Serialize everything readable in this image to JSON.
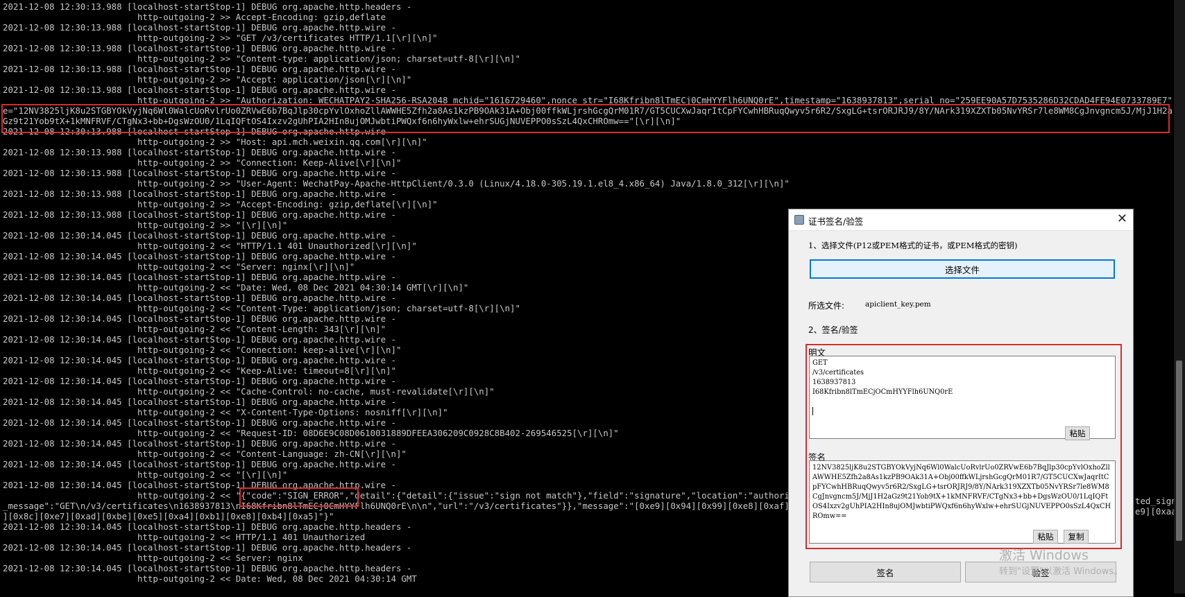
{
  "console": {
    "lines_top": [
      "2021-12-08 12:30:13.988 [localhost-startStop-1] DEBUG org.apache.http.headers -",
      "                          http-outgoing-2 >> Accept-Encoding: gzip,deflate",
      "2021-12-08 12:30:13.988 [localhost-startStop-1] DEBUG org.apache.http.wire -",
      "                          http-outgoing-2 >> \"GET /v3/certificates HTTP/1.1[\\r][\\n]\"",
      "2021-12-08 12:30:13.988 [localhost-startStop-1] DEBUG org.apache.http.wire -",
      "                          http-outgoing-2 >> \"Content-type: application/json; charset=utf-8[\\r][\\n]\"",
      "2021-12-08 12:30:13.988 [localhost-startStop-1] DEBUG org.apache.http.wire -",
      "                          http-outgoing-2 >> \"Accept: application/json[\\r][\\n]\"",
      "2021-12-08 12:30:13.988 [localhost-startStop-1] DEBUG org.apache.http.wire -",
      "                          http-outgoing-2 >> \"Authorization: WECHATPAY2-SHA256-RSA2048 mchid=\"1616729460\",nonce_str=\"I68Kfribn8lTmECj0CmHYYFlh6UNQ0rE\",timestamp=\"1638937813\",serial_no=\"259EE90A57D7535286D32CDAD4FE94E0733789E7\",signatur"
    ],
    "signature_lines": [
      "e=\"12NV3825ljK8u2STGBYOkVyjNq6Wl0WalcUoRvlrUo0ZRVwE6b7BqJlp30cpYvlOxhoZllAWWHE5Zfh2a8As1kzPB9OAk31A+Obj00ffkWLjrshGcgQrM01R7/GT5CUCXwJaqrItCpFYCwhHBRuqQwyv5r6R2/SxgLG+tsrORJRJ9/8Y/NArk319XZXTb05NvYRSr7le8WM8CgJnvgncm5J/MjJ1H2aGz9t21Yob9tX+1kMNFRVF/CTgNx3+bb+DgsWzOU0/1LqIQFtOS4Ixzv2gUhPIA2HIn8ujOMJwbtiPWQxf6n6hyWxlw+ehrSUGjNUVEPPO0sSzL4QxCHROmw==\"[\\r][\\n]\""
    ],
    "lines_mid": [
      "2021-12-08 12:30:13.988 [localhost-startStop-1] DEBUG org.apache.http.wire -",
      "                          http-outgoing-2 >> \"Host: api.mch.weixin.qq.com[\\r][\\n]\"",
      "2021-12-08 12:30:13.988 [localhost-startStop-1] DEBUG org.apache.http.wire -",
      "                          http-outgoing-2 >> \"Connection: Keep-Alive[\\r][\\n]\"",
      "2021-12-08 12:30:13.988 [localhost-startStop-1] DEBUG org.apache.http.wire -",
      "                          http-outgoing-2 >> \"User-Agent: WechatPay-Apache-HttpClient/0.3.0 (Linux/4.18.0-305.19.1.el8_4.x86_64) Java/1.8.0_312[\\r][\\n]\"",
      "2021-12-08 12:30:13.988 [localhost-startStop-1] DEBUG org.apache.http.wire -",
      "                          http-outgoing-2 >> \"Accept-Encoding: gzip,deflate[\\r][\\n]\"",
      "2021-12-08 12:30:13.988 [localhost-startStop-1] DEBUG org.apache.http.wire -",
      "                          http-outgoing-2 >> \"[\\r][\\n]\"",
      "2021-12-08 12:30:14.045 [localhost-startStop-1] DEBUG org.apache.http.wire -",
      "                          http-outgoing-2 << \"HTTP/1.1 401 Unauthorized[\\r][\\n]\"",
      "2021-12-08 12:30:14.045 [localhost-startStop-1] DEBUG org.apache.http.wire -",
      "                          http-outgoing-2 << \"Server: nginx[\\r][\\n]\"",
      "2021-12-08 12:30:14.045 [localhost-startStop-1] DEBUG org.apache.http.wire -",
      "                          http-outgoing-2 << \"Date: Wed, 08 Dec 2021 04:30:14 GMT[\\r][\\n]\"",
      "2021-12-08 12:30:14.045 [localhost-startStop-1] DEBUG org.apache.http.wire -",
      "                          http-outgoing-2 << \"Content-Type: application/json; charset=utf-8[\\r][\\n]\"",
      "2021-12-08 12:30:14.045 [localhost-startStop-1] DEBUG org.apache.http.wire -",
      "                          http-outgoing-2 << \"Content-Length: 343[\\r][\\n]\"",
      "2021-12-08 12:30:14.045 [localhost-startStop-1] DEBUG org.apache.http.wire -",
      "                          http-outgoing-2 << \"Connection: keep-alive[\\r][\\n]\"",
      "2021-12-08 12:30:14.045 [localhost-startStop-1] DEBUG org.apache.http.wire -",
      "                          http-outgoing-2 << \"Keep-Alive: timeout=8[\\r][\\n]\"",
      "2021-12-08 12:30:14.045 [localhost-startStop-1] DEBUG org.apache.http.wire -",
      "                          http-outgoing-2 << \"Cache-Control: no-cache, must-revalidate[\\r][\\n]\"",
      "2021-12-08 12:30:14.045 [localhost-startStop-1] DEBUG org.apache.http.wire -",
      "                          http-outgoing-2 << \"X-Content-Type-Options: nosniff[\\r][\\n]\"",
      "2021-12-08 12:30:14.045 [localhost-startStop-1] DEBUG org.apache.http.wire -",
      "                          http-outgoing-2 << \"Request-ID: 08D6E9C08D0610031889DFEEA306209C0928C8B402-269546525[\\r][\\n]\"",
      "2021-12-08 12:30:14.045 [localhost-startStop-1] DEBUG org.apache.http.wire -",
      "                          http-outgoing-2 << \"Content-Language: zh-CN[\\r][\\n]\"",
      "2021-12-08 12:30:14.045 [localhost-startStop-1] DEBUG org.apache.http.wire -",
      "                          http-outgoing-2 << \"[\\r][\\n]\"",
      "2021-12-08 12:30:14.045 [localhost-startStop-1] DEBUG org.apache.http.wire -"
    ],
    "error_line_1": "                          http-outgoing-2 << \"{\"code\":\"SIGN_ERROR\",\"detail\":{\"detail\":{\"issue\":\"sign not match\"},\"field\":\"signature\",\"location\":\"authorizati",
    "error_line_2": "_message\":\"GET\\n/v3/certificates\\n1638937813\\nI68Kfribn8lTmECj0CmHYYFlh6UNQ0rE\\n\\n\",\"url\":\"/v3/certificates\"}},\"message\":\"[0xe9][0x94][0x99][0xe8][0xaf][0xaf][0xe",
    "error_line_3": "][0x8c][0xe7][0xad][0xbe][0xe5][0xa4][0xb1][0xe8][0xb4][0xa5]\"}\"",
    "error_tail_right_1": "ted_sign",
    "error_tail_right_2": "e9][0xaa",
    "lines_bottom": [
      "2021-12-08 12:30:14.045 [localhost-startStop-1] DEBUG org.apache.http.headers -",
      "                          http-outgoing-2 << HTTP/1.1 401 Unauthorized",
      "2021-12-08 12:30:14.045 [localhost-startStop-1] DEBUG org.apache.http.headers -",
      "                          http-outgoing-2 << Server: nginx",
      "2021-12-08 12:30:14.045 [localhost-startStop-1] DEBUG org.apache.http.headers -",
      "                          http-outgoing-2 << Date: Wed, 08 Dec 2021 04:30:14 GMT"
    ]
  },
  "dialog": {
    "title": "证书签名/验签",
    "close_label": "✕",
    "step1_label": "1、选择文件(P12或PEM格式的证书，或PEM格式的密钥)",
    "choose_file_button": "选择文件",
    "selected_file_label": "所选文件:",
    "selected_file_value": "apiclient_key.pem",
    "step2_label": "2、签名/验签",
    "plaintext_label": "明文",
    "plaintext_value": "GET\n/v3/certificates\n1638937813\nI68Kfribn8lTmECjOCmHYYFlh6UNQ0rE\n\n",
    "paste_button": "粘贴",
    "signature_label": "签名",
    "signature_value": "12NV3825ljK8u2STGBYOkVyjNq6Wl0WalcUoRvlrUo0ZRVwE6b7BqJlp30cpYvlOxhoZllAWWHE5Zfh2a8As1kzPB9OAk31A+Obj00ffkWLjrshGcgQrM01R7/GT5CUCXwJaqrItCpFYCwhHBRuqQwyv5r6R2/SxgLG+tsrORJRJ9/8Y/NArk319XZXTb05NvYRSr7le8WM8CgJnvgncm5J/MjJ1H2aGz9t21Yob9tX+1kMNFRVF/CTgNx3+bb+DgsWzOU0/1LqIQFtOS4Ixzv2gUhPIA2HIn8ujOMJwbtiPWQxf6n6hyWxlw+ehrSUGjNUVEPPO0sSzL4QxCHROmw==",
    "sig_paste_button": "粘贴",
    "sig_copy_button": "复制",
    "sign_button": "签名",
    "verify_button": "验签"
  },
  "watermark": {
    "line1": "激活 Windows",
    "line2": "转到\"设置\"以激活 Windows。"
  },
  "colors": {
    "console_bg": "#000000",
    "console_text": "#c8c8c8",
    "highlight_red": "#d92b2b",
    "dialog_bg": "#f0f0f0",
    "primary_button_border": "#0078d7"
  }
}
